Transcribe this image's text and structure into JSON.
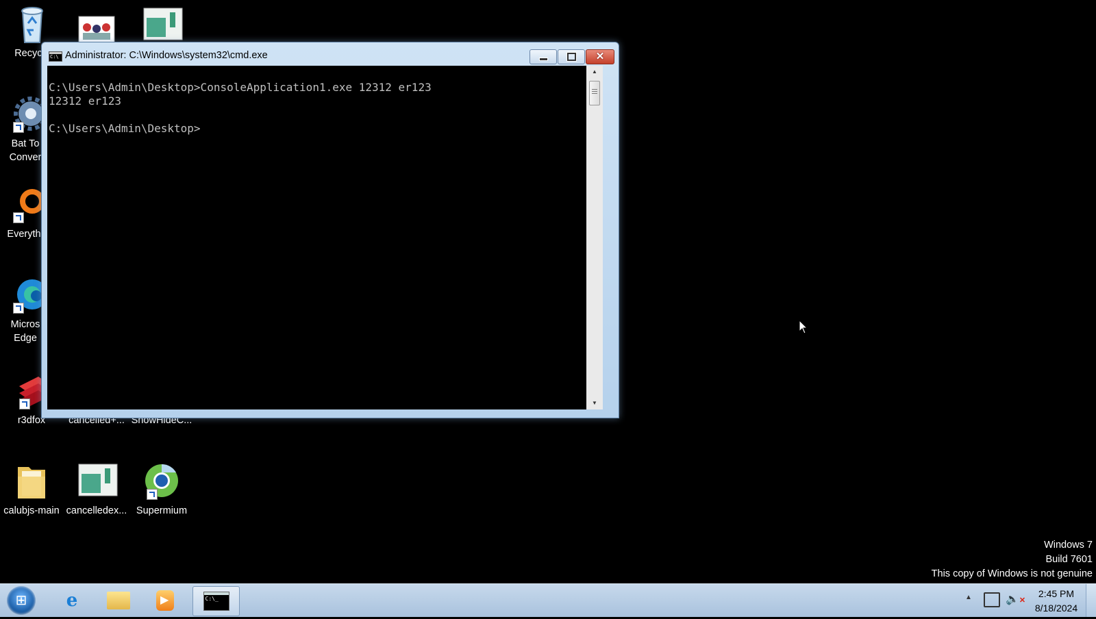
{
  "desktop_icons": [
    {
      "name": "recycle-bin",
      "label": "Recycle"
    },
    {
      "name": "bat-to-exe",
      "label": "Bat To\nConver"
    },
    {
      "name": "everything",
      "label": "Everyth"
    },
    {
      "name": "microsoft-edge",
      "label": "Micros\nEdge"
    },
    {
      "name": "r3dfox",
      "label": "r3dfox"
    },
    {
      "name": "cancelled-plus",
      "label": "cancelled+..."
    },
    {
      "name": "showhide",
      "label": "ShowHideC..."
    },
    {
      "name": "calubjs-main",
      "label": "calubjs-main"
    },
    {
      "name": "cancelledex",
      "label": "cancelledex..."
    },
    {
      "name": "supermium",
      "label": "Supermium"
    }
  ],
  "window": {
    "title": "Administrator: C:\\Windows\\system32\\cmd.exe",
    "close_glyph": "✕",
    "lines": [
      "C:\\Users\\Admin\\Desktop>ConsoleApplication1.exe 12312 er123",
      "12312 er123",
      "",
      "C:\\Users\\Admin\\Desktop>"
    ]
  },
  "watermark": {
    "line1": "Windows 7",
    "line2": "Build 7601",
    "line3": "This copy of Windows is not genuine"
  },
  "taskbar": {
    "start_glyph": "⊞",
    "ie_glyph": "e",
    "tray_arrow": "▲",
    "volume_glyph": "🔈",
    "mute_glyph": "✕",
    "clock_time": "2:45 PM",
    "clock_date": "8/18/2024"
  }
}
